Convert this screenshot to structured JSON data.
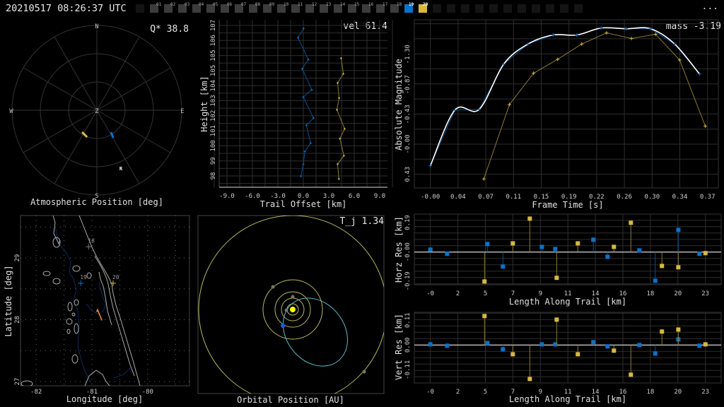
{
  "header": {
    "timestamp": "20210517 08:26:37 UTC",
    "menu_label": "...",
    "frames": [
      {
        "label": "",
        "state": "empty"
      },
      {
        "label": "01",
        "state": "inactive"
      },
      {
        "label": "02",
        "state": "inactive"
      },
      {
        "label": "03",
        "state": "inactive"
      },
      {
        "label": "04",
        "state": "inactive"
      },
      {
        "label": "05",
        "state": "inactive"
      },
      {
        "label": "06",
        "state": "inactive"
      },
      {
        "label": "07",
        "state": "inactive"
      },
      {
        "label": "08",
        "state": "inactive"
      },
      {
        "label": "09",
        "state": "inactive"
      },
      {
        "label": "10",
        "state": "inactive"
      },
      {
        "label": "11",
        "state": "inactive"
      },
      {
        "label": "12",
        "state": "inactive"
      },
      {
        "label": "13",
        "state": "inactive"
      },
      {
        "label": "14",
        "state": "inactive"
      },
      {
        "label": "15",
        "state": "inactive"
      },
      {
        "label": "16",
        "state": "inactive"
      },
      {
        "label": "17",
        "state": "inactive"
      },
      {
        "label": "18",
        "state": "inactive"
      },
      {
        "label": "19",
        "state": "blue"
      },
      {
        "label": "20",
        "state": "yellow"
      },
      {
        "label": "",
        "state": "empty"
      },
      {
        "label": "",
        "state": "empty"
      },
      {
        "label": "",
        "state": "empty"
      },
      {
        "label": "",
        "state": "empty"
      },
      {
        "label": "",
        "state": "empty"
      },
      {
        "label": "",
        "state": "empty"
      },
      {
        "label": "",
        "state": "empty"
      },
      {
        "label": "",
        "state": "empty"
      },
      {
        "label": "",
        "state": "empty"
      },
      {
        "label": "",
        "state": "empty"
      },
      {
        "label": "",
        "state": "empty"
      }
    ]
  },
  "colors": {
    "blue": "#0a72c8",
    "yellow": "#d8b840",
    "blue_dim": "#0b4f8a",
    "yellow_dim": "#8a7a30",
    "grid": "#2e2e2e",
    "text": "#dddddd",
    "orange": "#ff8c3a",
    "cyan": "#5fb8c8",
    "orbit": "#b8b860"
  },
  "chart_data": [
    {
      "type": "scatter",
      "title": "Atmospheric Position [deg]",
      "annotation": "Q* 38.8",
      "cardinals": {
        "N": "N",
        "E": "E",
        "S": "S",
        "W": "W",
        "Z": "Z"
      },
      "zenith_rings_deg": [
        30,
        60,
        90
      ],
      "tracks": [
        {
          "name": "station 19",
          "color": "blue",
          "points": [
            {
              "az": 147,
              "zen": 27.7
            },
            {
              "az": 149.5,
              "zen": 34
            }
          ]
        },
        {
          "name": "station 20",
          "color": "yellow",
          "points": [
            {
              "az": 214,
              "zen": 28
            },
            {
              "az": 200,
              "zen": 30.4
            }
          ]
        }
      ],
      "radiant": {
        "label": "R",
        "az": 157.5,
        "zen": 66.6
      }
    },
    {
      "type": "line",
      "annotation": "vel 61.4",
      "xlabel": "Trail Offset [km]",
      "ylabel": "Height [km]",
      "xticks": [
        "-9.0",
        "-6.0",
        "-3.0",
        "0.0",
        "3.0",
        "6.0",
        "9.0"
      ],
      "yticks": [
        "107",
        "106",
        "105",
        "105",
        "104",
        "103",
        "102",
        "101",
        "100",
        "99",
        "98"
      ],
      "xlim": [
        -9,
        9
      ],
      "ylim": [
        98,
        107
      ],
      "series": [
        {
          "name": "station 19",
          "color": "blue",
          "offset": [
            0.04,
            -0.63,
            0.59,
            -0.13,
            1.0,
            0.0,
            1.2,
            0.36,
            0.86,
            0.18,
            0.0,
            -0.28
          ],
          "height": [
            106.82,
            106.27,
            104.96,
            104.41,
            103.15,
            102.72,
            101.46,
            101.03,
            99.97,
            99.46,
            98.7,
            97.99
          ]
        },
        {
          "name": "station 20",
          "color": "yellow",
          "offset": [
            4.46,
            4.72,
            4.04,
            4.22,
            3.96,
            4.87,
            4.31,
            4.78,
            4.04,
            4.19
          ],
          "height": [
            105.04,
            104.11,
            103.56,
            102.66,
            101.96,
            100.82,
            100.23,
            99.21,
            98.71,
            97.82
          ]
        }
      ]
    },
    {
      "type": "line",
      "annotation": "mass -3.19",
      "xlabel": "Frame Time [s]",
      "ylabel": "Absolute Magnitude",
      "xticks": [
        "-0.00",
        "0.04",
        "0.07",
        "0.11",
        "0.15",
        "0.19",
        "0.22",
        "0.26",
        "0.30",
        "0.34",
        "0.37"
      ],
      "yticks": [
        "-1.30",
        "-0.87",
        "-0.43",
        "-0.00",
        "0.43"
      ],
      "yinverted": true,
      "series": [
        {
          "name": "station 19",
          "color": "blue",
          "t": [
            0,
            0.0325,
            0.0648,
            0.0973,
            0.1296,
            0.163,
            0.1946,
            0.2265,
            0.2597,
            0.2922,
            0.3244,
            0.3573
          ],
          "mag": [
            0.31,
            -0.49,
            -0.5,
            -1.15,
            -1.44,
            -1.57,
            -1.57,
            -1.67,
            -1.66,
            -1.66,
            -1.44,
            -1.01
          ]
        },
        {
          "name": "station 20",
          "color": "yellow",
          "t": [
            0.071,
            0.105,
            0.137,
            0.169,
            0.201,
            0.234,
            0.267,
            0.299,
            0.331,
            0.365
          ],
          "mag": [
            0.5,
            -0.57,
            -1.02,
            -1.22,
            -1.44,
            -1.6,
            -1.52,
            -1.58,
            -1.21,
            -0.26
          ]
        }
      ],
      "fit": {
        "name": "fit curve",
        "color": "white",
        "source_series": "station 19"
      }
    },
    {
      "type": "scatter",
      "xlabel": "Length Along Trail [km]",
      "ylabel": "Horz Res [km]",
      "xticks": [
        "-0",
        "2",
        "5",
        "7",
        "9",
        "11",
        "14",
        "16",
        "18",
        "20",
        "23"
      ],
      "yticks": [
        "0.19",
        "-0.00",
        "-0.19"
      ],
      "series": [
        {
          "name": "station 19",
          "color": "blue",
          "length": [
            0,
            1.4,
            4.77,
            6.07,
            9.33,
            10.45,
            13.64,
            14.83,
            17.49,
            18.82,
            20.75,
            22.52
          ],
          "res": [
            0.016,
            -0.012,
            0.053,
            -0.095,
            0.034,
            0.02,
            0.081,
            -0.031,
            0.011,
            -0.188,
            0.145,
            -0.012
          ]
        },
        {
          "name": "station 20",
          "color": "yellow",
          "length": [
            4.53,
            6.9,
            8.32,
            10.57,
            12.34,
            15.36,
            16.78,
            19.38,
            20.75,
            23.02
          ],
          "res": [
            -0.193,
            0.057,
            0.219,
            -0.169,
            0.057,
            0.034,
            0.192,
            -0.091,
            -0.1,
            -0.007
          ]
        }
      ]
    },
    {
      "type": "scatter",
      "xlabel": "Length Along Trail [km]",
      "ylabel": "Vert Res [km]",
      "xticks": [
        "-0",
        "2",
        "5",
        "7",
        "9",
        "11",
        "14",
        "16",
        "18",
        "20",
        "23"
      ],
      "yticks": [
        "0.11",
        "0.00",
        "-0.11"
      ],
      "series": [
        {
          "name": "station 19",
          "color": "blue",
          "length": [
            0,
            1.4,
            4.77,
            6.07,
            9.33,
            10.45,
            13.64,
            14.83,
            17.49,
            18.82,
            20.75,
            22.52
          ],
          "res": [
            0.003,
            -0.003,
            0.009,
            -0.019,
            0.003,
            0.003,
            0.013,
            -0.006,
            0.0,
            -0.038,
            0.025,
            -0.003
          ]
        },
        {
          "name": "station 20",
          "color": "yellow",
          "length": [
            4.53,
            6.9,
            8.32,
            10.57,
            12.34,
            15.36,
            16.78,
            19.38,
            20.75,
            23.02
          ],
          "res": [
            0.129,
            -0.041,
            -0.151,
            0.113,
            -0.041,
            -0.025,
            -0.132,
            0.06,
            0.069,
            0.003
          ]
        }
      ]
    },
    {
      "type": "scatter",
      "xlabel": "Longitude [deg]",
      "ylabel": "Latitude [deg]",
      "xticks": [
        "-82",
        "-81",
        "-80"
      ],
      "yticks": [
        "29",
        "28",
        "27"
      ],
      "stations": [
        {
          "label": "18",
          "lon": -81.06,
          "lat": 29.18,
          "color": "grey"
        },
        {
          "label": "19",
          "lon": -81.2,
          "lat": 28.59,
          "color": "blue"
        },
        {
          "label": "20",
          "lon": -80.62,
          "lat": 28.59,
          "color": "yellow"
        }
      ],
      "trajectory": {
        "color": "orange",
        "start": {
          "lon": -80.82,
          "lat": 27.99
        },
        "end": {
          "lon": -80.9,
          "lat": 28.16
        }
      }
    },
    {
      "type": "scatter",
      "title": "Orbital Position [AU]",
      "annotation": "T_j 1.34"
    }
  ]
}
